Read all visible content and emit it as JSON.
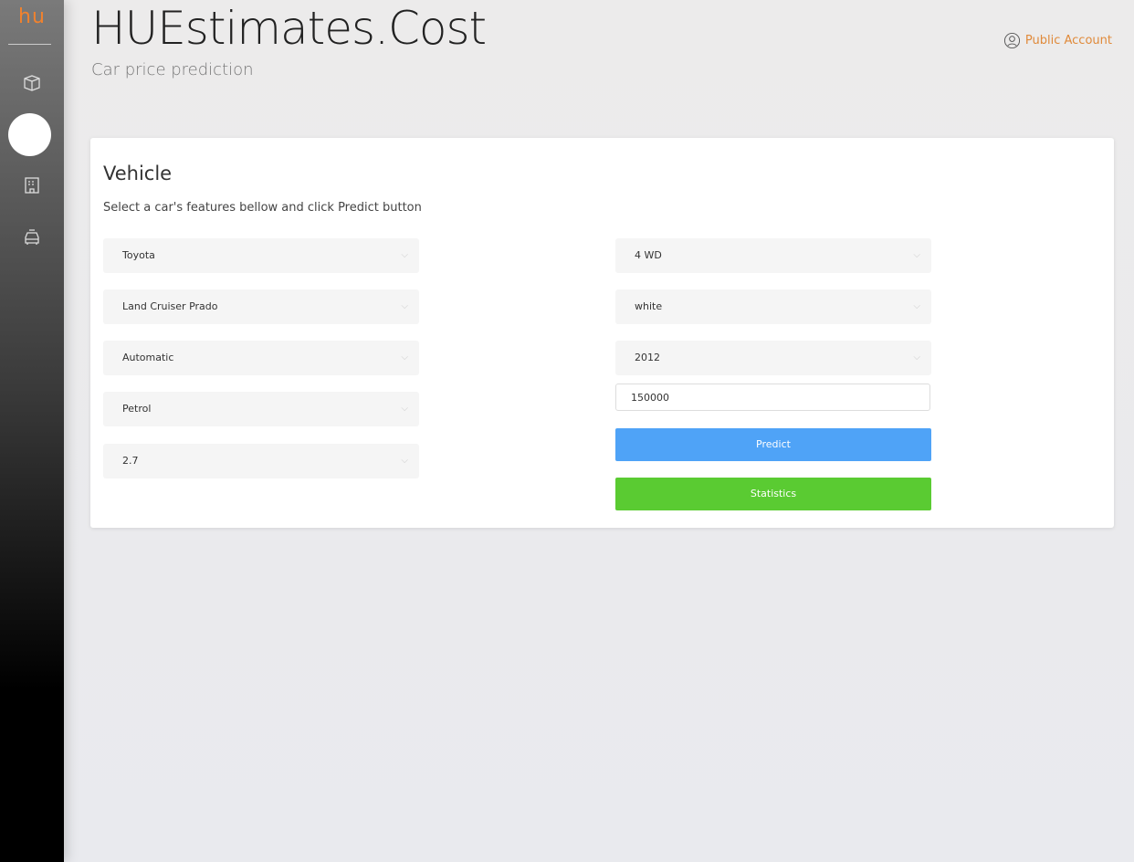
{
  "sidebar": {
    "logo": "hu",
    "items": [
      {
        "icon": "cube-icon"
      },
      {
        "icon": "active-circle"
      },
      {
        "icon": "building-icon"
      },
      {
        "icon": "taxi-icon"
      }
    ]
  },
  "header": {
    "title": "HUEstimates.Cost",
    "subtitle": "Car price prediction",
    "account": "Public Account"
  },
  "card": {
    "title": "Vehicle",
    "instructions": "Select a car's features bellow and click Predict button",
    "left": [
      "Toyota",
      "Land Cruiser Prado",
      "Automatic",
      "Petrol",
      "2.7"
    ],
    "right": [
      "4 WD",
      "white",
      "2012"
    ],
    "mileage": "150000",
    "predict": "Predict",
    "statistics": "Statistics"
  },
  "colors": {
    "accent": "#f0822e",
    "predict": "#4fa3f7",
    "statistics": "#5acb32"
  }
}
